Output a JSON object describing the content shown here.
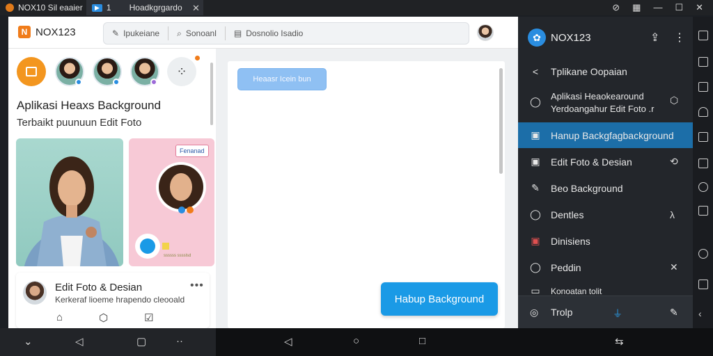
{
  "titlebar": {
    "tab1": "NOX10 Sil eaaier",
    "tab2_icon_label": "1",
    "tab2": "Hoadkgrgardo",
    "close": "✕",
    "window_controls": [
      "⊘",
      "▦",
      "—",
      "☐",
      "✕"
    ]
  },
  "appbar": {
    "logo_text": "NOX123",
    "search_items": [
      "Ipukeiane",
      "Sonoanl",
      "Dosnolio Isadio"
    ]
  },
  "left": {
    "title": "Aplikasi Heaxs Background",
    "subtitle": "Terbaikt puunuun Edit Foto",
    "tag": "Fenanad",
    "card_caption": "ssssss sssslsd",
    "edit_card": {
      "title": "Edit Foto & Desian",
      "subtitle": "Kerkeraf lioeme hrapendo cleooald",
      "dots": "•••"
    }
  },
  "content": {
    "chip": "Heaasr Icein bun",
    "primary_button": "Habup Background"
  },
  "menu": {
    "logo_text": "NOX123",
    "items": [
      {
        "label": "Tplikane Oopaian",
        "icon": "<"
      },
      {
        "label": "Aplikasi Heaokearound Yerdoangahur Edit Foto .r",
        "icon": "◯"
      },
      {
        "label": "Hanup Backgfagbackground",
        "icon": "▣"
      },
      {
        "label": "Edit Foto & Desian",
        "icon": "▣"
      },
      {
        "label": "Beo Background",
        "icon": "✎"
      },
      {
        "label": "Dentles",
        "icon": "◯"
      },
      {
        "label": "Dinisiens",
        "icon": "▣"
      },
      {
        "label": "Peddin",
        "icon": "◯"
      },
      {
        "label": "Konoatan tolit",
        "icon": "▭"
      }
    ],
    "bottom_label": "Trolp"
  },
  "colors": {
    "accent_orange": "#f07c1a",
    "accent_blue": "#1a9ae6",
    "menu_active": "#1c6ea8"
  }
}
